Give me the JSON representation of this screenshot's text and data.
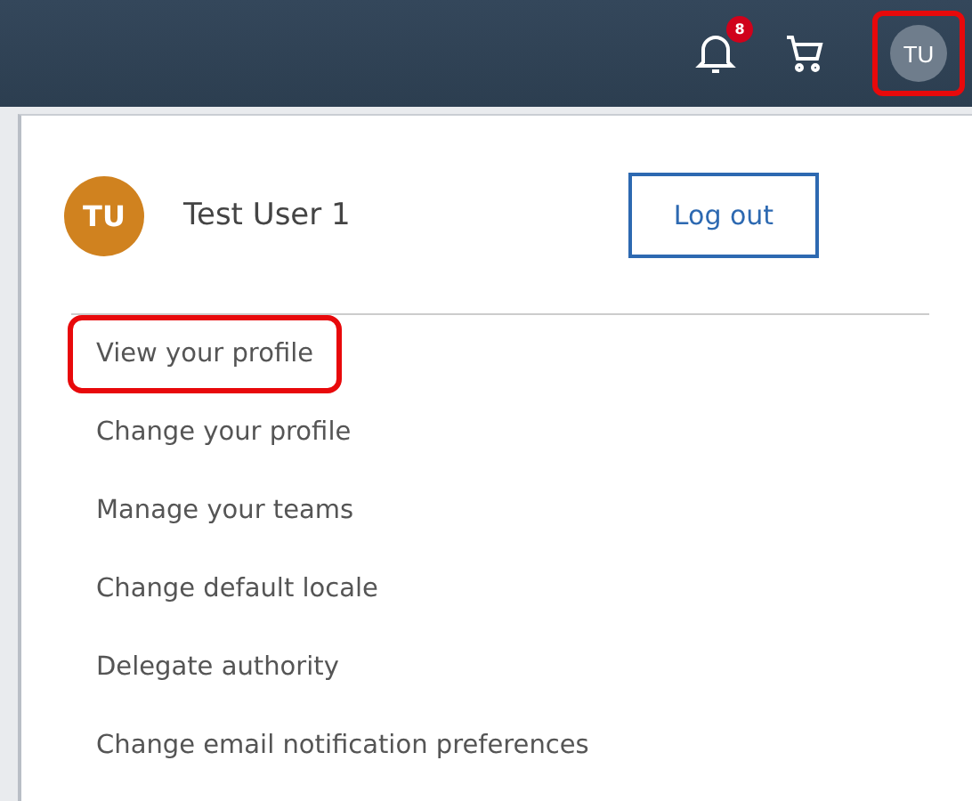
{
  "header": {
    "notification_count": "8",
    "avatar": {
      "initials": "TU",
      "highlighted": true
    }
  },
  "user_menu": {
    "avatar_initials": "TU",
    "user_name": "Test User 1",
    "logout_button": "Log out",
    "items": [
      {
        "label": "View your profile",
        "highlighted": true
      },
      {
        "label": "Change your profile",
        "highlighted": false
      },
      {
        "label": "Manage your teams",
        "highlighted": false
      },
      {
        "label": "Change default locale",
        "highlighted": false
      },
      {
        "label": "Delegate authority",
        "highlighted": false
      },
      {
        "label": "Change email notification preferences",
        "highlighted": false
      }
    ]
  }
}
